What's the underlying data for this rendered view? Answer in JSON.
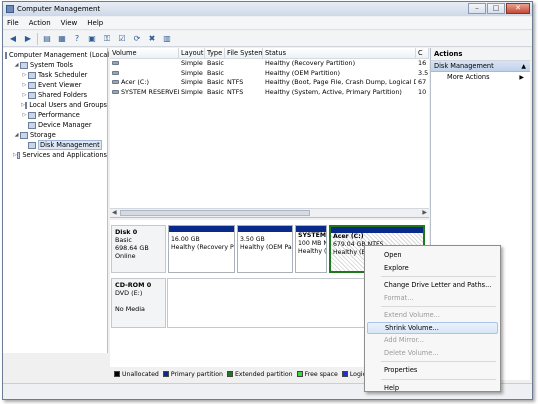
{
  "window": {
    "title": "Computer Management"
  },
  "menu": [
    "File",
    "Action",
    "View",
    "Help"
  ],
  "tree": [
    {
      "label": "Computer Management (Local",
      "level": 0,
      "expander": ""
    },
    {
      "label": "System Tools",
      "level": 1,
      "expander": "◢"
    },
    {
      "label": "Task Scheduler",
      "level": 2,
      "expander": "▷"
    },
    {
      "label": "Event Viewer",
      "level": 2,
      "expander": "▷"
    },
    {
      "label": "Shared Folders",
      "level": 2,
      "expander": "▷"
    },
    {
      "label": "Local Users and Groups",
      "level": 2,
      "expander": "▷"
    },
    {
      "label": "Performance",
      "level": 2,
      "expander": "▷"
    },
    {
      "label": "Device Manager",
      "level": 2,
      "expander": ""
    },
    {
      "label": "Storage",
      "level": 1,
      "expander": "◢"
    },
    {
      "label": "Disk Management",
      "level": 2,
      "expander": ""
    },
    {
      "label": "Services and Applications",
      "level": 1,
      "expander": "▷"
    }
  ],
  "volume_table": {
    "headers": [
      "Volume",
      "Layout",
      "Type",
      "File System",
      "Status",
      "C"
    ],
    "rows": [
      [
        "",
        "Simple",
        "Basic",
        "",
        "Healthy (Recovery Partition)",
        "16"
      ],
      [
        "",
        "Simple",
        "Basic",
        "",
        "Healthy (OEM Partition)",
        "3.5"
      ],
      [
        "Acer (C:)",
        "Simple",
        "Basic",
        "NTFS",
        "Healthy (Boot, Page File, Crash Dump, Logical Drive)",
        "67"
      ],
      [
        "SYSTEM RESERVED",
        "Simple",
        "Basic",
        "NTFS",
        "Healthy (System, Active, Primary Partition)",
        "10"
      ]
    ]
  },
  "disks": {
    "disk0": {
      "name": "Disk 0",
      "type": "Basic",
      "size": "698.64 GB",
      "state": "Online"
    },
    "cdrom0": {
      "name": "CD-ROM 0",
      "type": "DVD (E:)",
      "media": "No Media"
    }
  },
  "partitions": [
    {
      "title": "",
      "size": "16.00 GB",
      "status": "Healthy (Recovery Pa"
    },
    {
      "title": "",
      "size": "3.50 GB",
      "status": "Healthy (OEM Par"
    },
    {
      "title": "SYSTEM",
      "size": "100 MB N",
      "status": "Healthy (Sy"
    },
    {
      "title": "Acer (C:)",
      "size": "679.04 GB NTFS",
      "status": "Healthy (Bo"
    }
  ],
  "legend": [
    {
      "label": "Unallocated",
      "color": "#000000"
    },
    {
      "label": "Primary partition",
      "color": "#0a2a8a"
    },
    {
      "label": "Extended partition",
      "color": "#1c7a1c"
    },
    {
      "label": "Free space",
      "color": "#3ad63a"
    },
    {
      "label": "Logical drive",
      "color": "#1a2fd6"
    }
  ],
  "actions": {
    "header": "Actions",
    "section": "Disk Management",
    "items": [
      "More Actions"
    ]
  },
  "context_menu": [
    {
      "label": "Open",
      "disabled": false
    },
    {
      "label": "Explore",
      "disabled": false
    },
    {
      "sep": true
    },
    {
      "label": "Change Drive Letter and Paths...",
      "disabled": false
    },
    {
      "label": "Format...",
      "disabled": true
    },
    {
      "sep": true
    },
    {
      "label": "Extend Volume...",
      "disabled": true
    },
    {
      "label": "Shrink Volume...",
      "disabled": false,
      "hover": true
    },
    {
      "label": "Add Mirror...",
      "disabled": true
    },
    {
      "label": "Delete Volume...",
      "disabled": true
    },
    {
      "sep": true
    },
    {
      "label": "Properties",
      "disabled": false
    },
    {
      "sep": true
    },
    {
      "label": "Help",
      "disabled": false
    }
  ]
}
